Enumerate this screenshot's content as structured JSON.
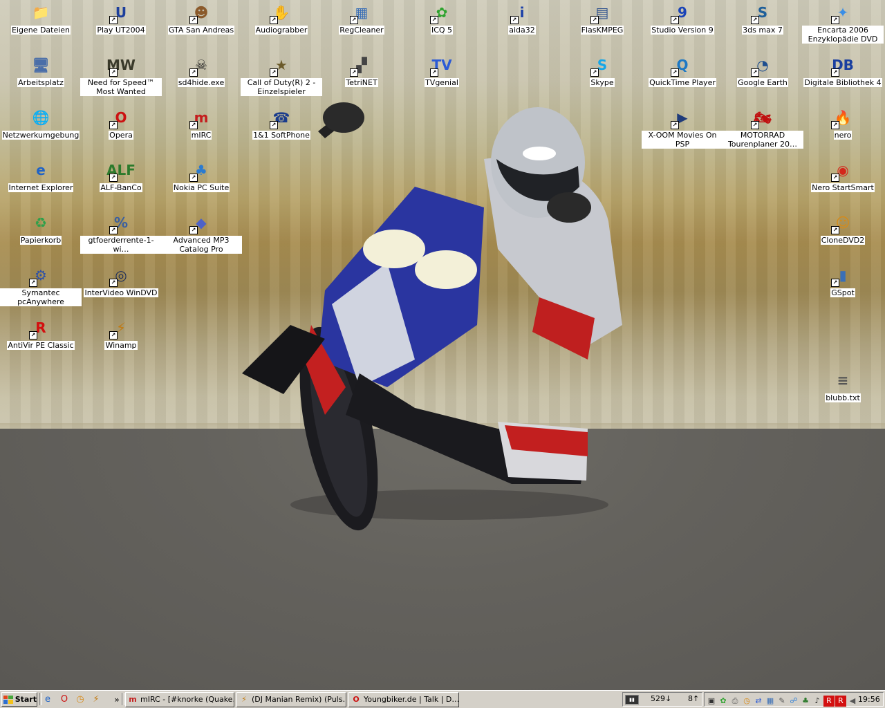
{
  "desktop": {
    "icons": [
      {
        "label": "Eigene Dateien",
        "icon": "my-documents-icon",
        "glyph": "📁",
        "color": "#e0b44a"
      },
      {
        "label": "Play UT2004",
        "icon": "ut2004-icon",
        "glyph": "U",
        "color": "#1d3f9c"
      },
      {
        "label": "GTA San Andreas",
        "icon": "gta-san-andreas-icon",
        "glyph": "☻",
        "color": "#8b5a2b"
      },
      {
        "label": "Audiograbber",
        "icon": "audiograbber-icon",
        "glyph": "✋",
        "color": "#a0522d"
      },
      {
        "label": "RegCleaner",
        "icon": "regcleaner-icon",
        "glyph": "▦",
        "color": "#3b6fb6"
      },
      {
        "label": "ICQ 5",
        "icon": "icq-icon",
        "glyph": "✿",
        "color": "#2fa32f"
      },
      {
        "label": "aida32",
        "icon": "aida32-icon",
        "glyph": "i",
        "color": "#1b3fa8"
      },
      {
        "label": "FlasKMPEG",
        "icon": "flaskmpeg-icon",
        "glyph": "▤",
        "color": "#2a4e8c"
      },
      {
        "label": "Studio Version 9",
        "icon": "studio-9-icon",
        "glyph": "9",
        "color": "#1a44b8"
      },
      {
        "label": "3ds max 7",
        "icon": "3ds-max-icon",
        "glyph": "S",
        "color": "#1e5f9a"
      },
      {
        "label": "Encarta 2006 Enzyklopädie DVD",
        "icon": "encarta-icon",
        "glyph": "✦",
        "color": "#3a8ee6"
      },
      {
        "label": "Arbeitsplatz",
        "icon": "my-computer-icon",
        "glyph": "🖥",
        "color": "#4a6ea8"
      },
      {
        "label": "Need for Speed™ Most Wanted",
        "icon": "nfs-most-wanted-icon",
        "glyph": "MW",
        "color": "#3a3a2a"
      },
      {
        "label": "sd4hide.exe",
        "icon": "skull-icon",
        "glyph": "☠",
        "color": "#222"
      },
      {
        "label": "Call of Duty(R) 2 - Einzelspieler",
        "icon": "call-of-duty-icon",
        "glyph": "★",
        "color": "#6b5a2a"
      },
      {
        "label": "TetriNET",
        "icon": "tetrinet-icon",
        "glyph": "▞",
        "color": "#444"
      },
      {
        "label": "TVgenial",
        "icon": "tvgenial-icon",
        "glyph": "TV",
        "color": "#2c5bd6"
      },
      {
        "label": "Skype",
        "icon": "skype-icon",
        "glyph": "S",
        "color": "#15a6e8"
      },
      {
        "label": "QuickTime Player",
        "icon": "quicktime-icon",
        "glyph": "Q",
        "color": "#1d78c4"
      },
      {
        "label": "Google Earth",
        "icon": "google-earth-icon",
        "glyph": "◔",
        "color": "#1f4f8f"
      },
      {
        "label": "Digitale Bibliothek 4",
        "icon": "digitale-bibliothek-icon",
        "glyph": "DB",
        "color": "#1a3fa0"
      },
      {
        "label": "Netzwerkumgebung",
        "icon": "network-places-icon",
        "glyph": "🌐",
        "color": "#2d7ed8"
      },
      {
        "label": "Opera",
        "icon": "opera-icon",
        "glyph": "O",
        "color": "#cc1111"
      },
      {
        "label": "mIRC",
        "icon": "mirc-icon",
        "glyph": "m",
        "color": "#c41e1e"
      },
      {
        "label": "1&1 SoftPhone",
        "icon": "softphone-icon",
        "glyph": "☎",
        "color": "#1b3c8c"
      },
      {
        "label": "X-OOM Movies On PSP",
        "icon": "xoom-psp-icon",
        "glyph": "▶",
        "color": "#1f3b7a"
      },
      {
        "label": "MOTORRAD Tourenplaner 20…",
        "icon": "motorrad-tourenplaner-icon",
        "glyph": "🏍",
        "color": "#c01010"
      },
      {
        "label": "nero",
        "icon": "nero-icon",
        "glyph": "🔥",
        "color": "#d8501b"
      },
      {
        "label": "Internet Explorer",
        "icon": "internet-explorer-icon",
        "glyph": "e",
        "color": "#1f63c6"
      },
      {
        "label": "ALF-BanCo",
        "icon": "alf-banco-icon",
        "glyph": "ALF",
        "color": "#2c7a2c"
      },
      {
        "label": "Nokia PC Suite",
        "icon": "nokia-pc-suite-icon",
        "glyph": "♣",
        "color": "#2b7bd0"
      },
      {
        "label": "Nero StartSmart",
        "icon": "nero-startsmart-icon",
        "glyph": "◉",
        "color": "#d4261b"
      },
      {
        "label": "Papierkorb",
        "icon": "recycle-bin-icon",
        "glyph": "♻",
        "color": "#2ea04a"
      },
      {
        "label": "gtfoerderrente-1-wi…",
        "icon": "gtfoerderrente-icon",
        "glyph": "%",
        "color": "#3a5fa0"
      },
      {
        "label": "Advanced MP3 Catalog Pro",
        "icon": "mp3-catalog-icon",
        "glyph": "◆",
        "color": "#4d62c9"
      },
      {
        "label": "CloneDVD2",
        "icon": "clonedvd-icon",
        "glyph": "☺",
        "color": "#d88a16"
      },
      {
        "label": "Symantec pcAnywhere",
        "icon": "pcanywhere-icon",
        "glyph": "⚙",
        "color": "#2c4fa8"
      },
      {
        "label": "InterVideo WinDVD",
        "icon": "windvd-icon",
        "glyph": "◎",
        "color": "#1d2e5a"
      },
      {
        "label": "GSpot",
        "icon": "gspot-icon",
        "glyph": "▮",
        "color": "#3a6fb6"
      },
      {
        "label": "AntiVir PE Classic",
        "icon": "antivir-icon",
        "glyph": "R",
        "color": "#d31010"
      },
      {
        "label": "Winamp",
        "icon": "winamp-icon",
        "glyph": "⚡",
        "color": "#c27a10"
      },
      {
        "label": "blubb.txt",
        "icon": "text-file-icon",
        "glyph": "≡",
        "color": "#555"
      }
    ]
  },
  "taskbar": {
    "start_label": "Start",
    "overflow_label": "»",
    "tasks": [
      {
        "label": "mIRC - [#knorke (Quake…",
        "icon": "mirc-icon",
        "glyph": "m",
        "color": "#c41e1e"
      },
      {
        "label": "(DJ Manian Remix) (Puls…",
        "icon": "winamp-icon",
        "glyph": "⚡",
        "color": "#c27a10"
      },
      {
        "label": "Youngbiker.de | Talk | D…",
        "icon": "opera-icon",
        "glyph": "O",
        "color": "#cc1111"
      }
    ],
    "net_meter": {
      "down": "529↓",
      "up": "8↑"
    },
    "clock": "19:56"
  }
}
